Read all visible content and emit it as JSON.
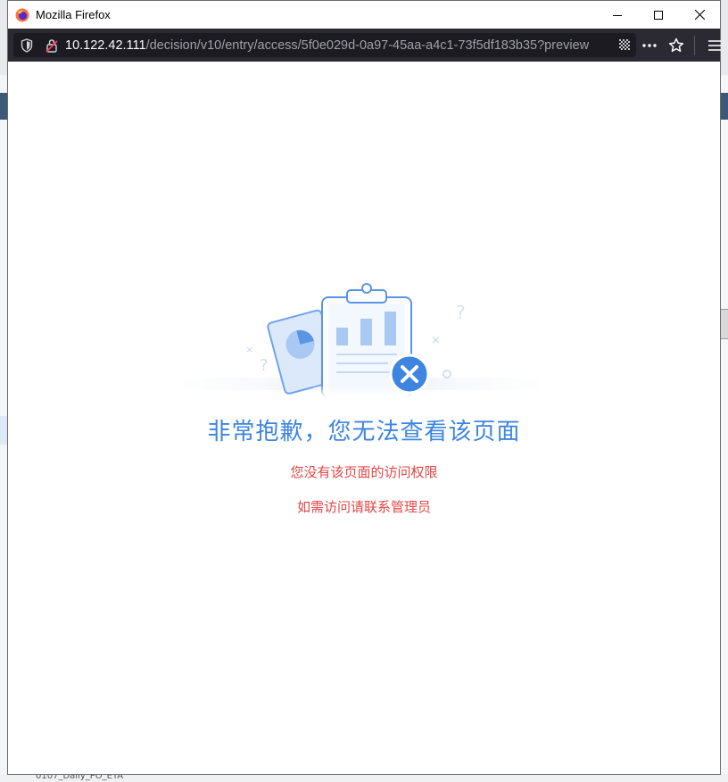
{
  "window": {
    "title": "Mozilla Firefox",
    "controls": [
      "minimize",
      "maximize",
      "close"
    ]
  },
  "toolbar": {
    "url_host": "10.122.42.111",
    "url_path": "/decision/v10/entry/access/5f0e029d-0a97-45aa-a4c1-73f5df183b35?preview",
    "icons": [
      "tracking-shield-icon",
      "insecure-lock-icon",
      "qr-code-icon",
      "more-actions-icon",
      "bookmark-star-icon",
      "menu-icon"
    ]
  },
  "page": {
    "headline": "非常抱歉，您无法查看该页面",
    "message1": "您没有该页面的访问权限",
    "message2": "如需访问请联系管理员"
  },
  "background": {
    "bottom_fragment": "0107_Daily_PO_ETA"
  },
  "colors": {
    "accent": "#3d85e0",
    "error": "#e54545",
    "toolbar": "#2b2a33",
    "urlbar": "#1c1b22"
  }
}
